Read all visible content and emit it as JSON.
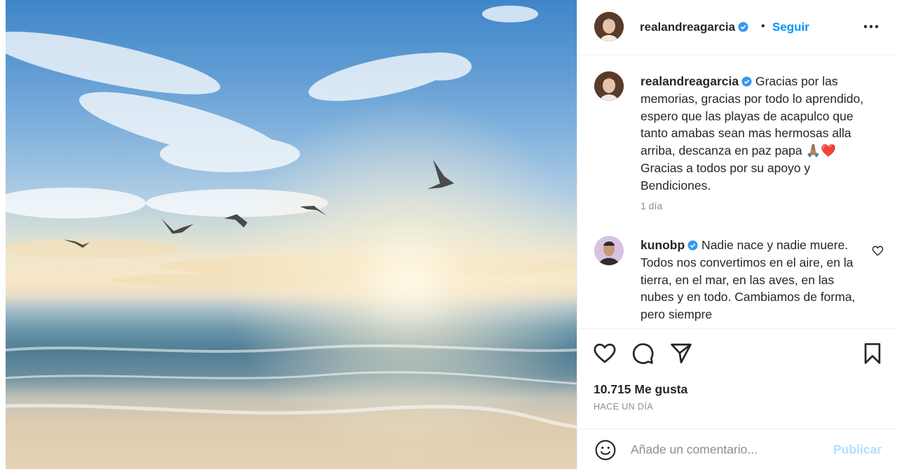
{
  "post": {
    "username": "realandreagarcia",
    "header_separator": "•",
    "follow_label": "Seguir",
    "caption_username": "realandreagarcia",
    "caption_text": " Gracias por las memorias, gracias por todo lo aprendido, espero que las playas de acapulco que tanto amabas sean mas hermosas alla arriba, descanza en paz papa 🙏🏽❤️ Gracias a todos por su apoyo y Bendiciones.",
    "caption_time": "1 día",
    "likes": "10.715 Me gusta",
    "time_ago": "HACE UN DÍA"
  },
  "comments": [
    {
      "username": "kunobp",
      "text": " Nadie nace y nadie muere. Todos nos convertimos en el aire, en la tierra, en el mar, en las aves, en las nubes y en todo. Cambiamos de forma, pero siempre"
    }
  ],
  "add_comment": {
    "placeholder": "Añade un comentario...",
    "publish_label": "Publicar"
  },
  "icons": {
    "verified": "verified-badge-icon",
    "more": "more-options-icon",
    "like": "heart-icon",
    "comment": "comment-icon",
    "share": "paper-plane-icon",
    "save": "bookmark-icon",
    "emoji": "emoji-icon"
  },
  "colors": {
    "accent": "#0095f6",
    "publish_disabled": "#b2dffc",
    "muted": "#8e8e8e"
  }
}
